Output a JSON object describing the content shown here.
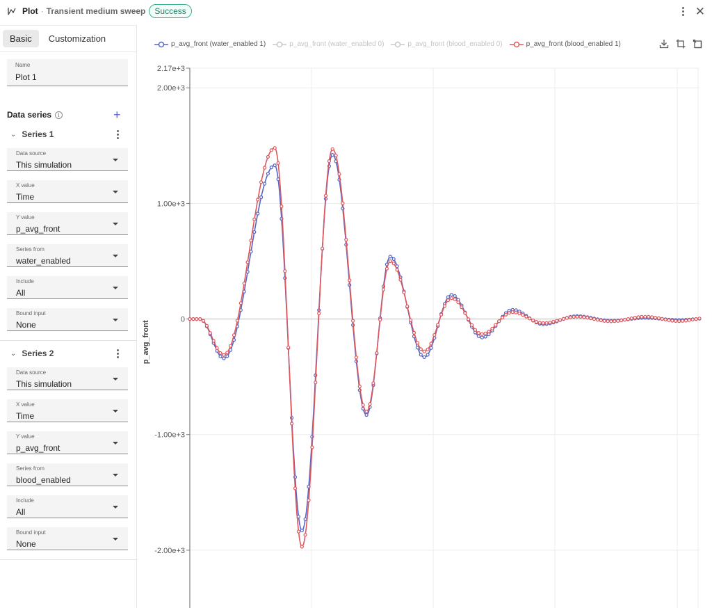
{
  "header": {
    "title": "Plot",
    "separator": "·",
    "subtitle": "Transient medium sweep",
    "status": "Success"
  },
  "tabs": [
    "Basic",
    "Customization"
  ],
  "name_field": {
    "label": "Name",
    "value": "Plot 1"
  },
  "data_series": {
    "title": "Data series",
    "series": [
      {
        "title": "Series 1",
        "fields": [
          {
            "label": "Data source",
            "value": "This simulation"
          },
          {
            "label": "X value",
            "value": "Time"
          },
          {
            "label": "Y value",
            "value": "p_avg_front"
          },
          {
            "label": "Series from",
            "value": "water_enabled"
          },
          {
            "label": "Include",
            "value": "All"
          },
          {
            "label": "Bound input",
            "value": "None"
          }
        ]
      },
      {
        "title": "Series 2",
        "fields": [
          {
            "label": "Data source",
            "value": "This simulation"
          },
          {
            "label": "X value",
            "value": "Time"
          },
          {
            "label": "Y value",
            "value": "p_avg_front"
          },
          {
            "label": "Series from",
            "value": "blood_enabled"
          },
          {
            "label": "Include",
            "value": "All"
          },
          {
            "label": "Bound input",
            "value": "None"
          }
        ]
      }
    ]
  },
  "colors": {
    "accent": "#5a63c9",
    "success": "#2fb292",
    "series_water": "#5566c4",
    "series_blood": "#e0575c",
    "series_hidden": "#c8c8c8"
  },
  "icons": [
    "plot-icon",
    "kebab-icon",
    "close-icon",
    "info-icon",
    "plus-icon",
    "chevron-down-icon",
    "download-icon",
    "crop-icon",
    "resize-icon"
  ],
  "chart_data": {
    "type": "line",
    "xlabel": "",
    "ylabel": "p_avg_front",
    "ylim": [
      -2500,
      2170
    ],
    "y_ticks": [
      {
        "value": 2170,
        "label": "2.17e+3"
      },
      {
        "value": 2000,
        "label": "2.00e+3"
      },
      {
        "value": 1000,
        "label": "1.00e+3"
      },
      {
        "value": 0,
        "label": "0"
      },
      {
        "value": -1000,
        "label": "-1.00e+3"
      },
      {
        "value": -2000,
        "label": "-2.00e+3"
      }
    ],
    "grid": true,
    "legend_position": "top-left",
    "series": [
      {
        "name": "p_avg_front (water_enabled 1)",
        "visible": true,
        "peaks": [
          [
            10,
            -340
          ],
          [
            25,
            1330
          ],
          [
            33,
            -1830
          ],
          [
            42,
            1420
          ],
          [
            52,
            -830
          ],
          [
            59,
            540
          ],
          [
            69,
            -330
          ],
          [
            77,
            210
          ],
          [
            86,
            -160
          ],
          [
            95,
            80
          ],
          [
            104,
            -45
          ],
          [
            114,
            25
          ],
          [
            124,
            -15
          ],
          [
            134,
            10
          ],
          [
            144,
            -8
          ]
        ]
      },
      {
        "name": "p_avg_front (water_enabled 0)",
        "visible": false,
        "peaks": []
      },
      {
        "name": "p_avg_front (blood_enabled 0)",
        "visible": false,
        "peaks": []
      },
      {
        "name": "p_avg_front (blood_enabled 1)",
        "visible": true,
        "peaks": [
          [
            10,
            -310
          ],
          [
            25,
            1480
          ],
          [
            33,
            -1970
          ],
          [
            42,
            1470
          ],
          [
            52,
            -800
          ],
          [
            59,
            500
          ],
          [
            69,
            -280
          ],
          [
            77,
            180
          ],
          [
            86,
            -130
          ],
          [
            95,
            60
          ],
          [
            104,
            -35
          ],
          [
            114,
            20
          ],
          [
            124,
            -20
          ],
          [
            134,
            20
          ],
          [
            144,
            -18
          ]
        ]
      }
    ]
  }
}
